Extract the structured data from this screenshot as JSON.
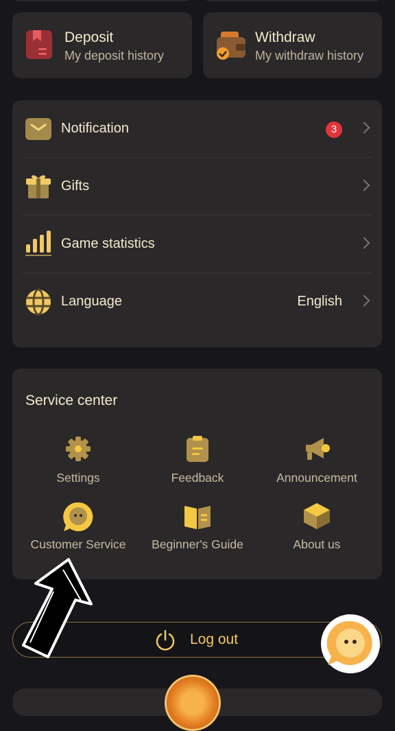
{
  "history": {
    "deposit": {
      "title": "Deposit",
      "subtitle": "My deposit history"
    },
    "withdraw": {
      "title": "Withdraw",
      "subtitle": "My withdraw history"
    }
  },
  "menu": {
    "notification": {
      "label": "Notification",
      "badge": "3"
    },
    "gifts": {
      "label": "Gifts"
    },
    "game_statistics": {
      "label": "Game statistics"
    },
    "language": {
      "label": "Language",
      "value": "English"
    }
  },
  "service_center": {
    "title": "Service center",
    "items": [
      {
        "label": "Settings",
        "icon": "gear-icon"
      },
      {
        "label": "Feedback",
        "icon": "clipboard-icon"
      },
      {
        "label": "Announcement",
        "icon": "megaphone-icon"
      },
      {
        "label": "Customer Service",
        "icon": "chat-bubble-icon"
      },
      {
        "label": "Beginner's Guide",
        "icon": "book-icon"
      },
      {
        "label": "About us",
        "icon": "cube-icon"
      }
    ]
  },
  "logout": {
    "label": "Log out"
  },
  "colors": {
    "accent": "#f0c866",
    "card": "#2a2829",
    "background": "#17161a",
    "badge": "#e2343b"
  }
}
